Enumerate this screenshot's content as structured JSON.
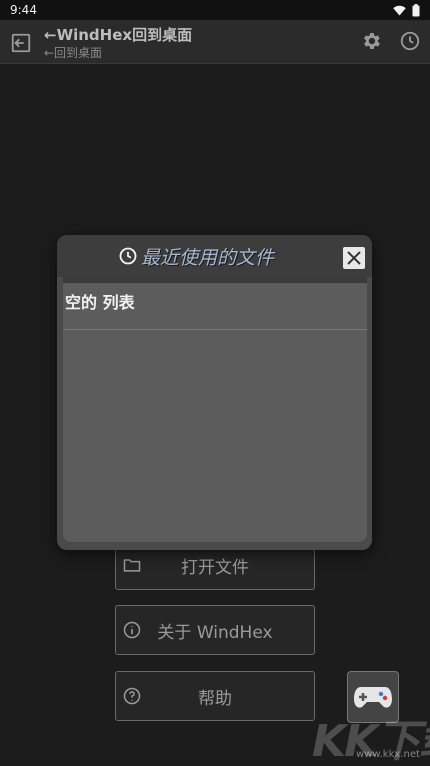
{
  "status_bar": {
    "time": "9:44"
  },
  "app_bar": {
    "title": "←WindHex回到桌面",
    "subtitle": "←回到桌面",
    "icons": [
      "exit-icon",
      "gear-icon",
      "clock-icon"
    ]
  },
  "buttons": {
    "open_file": "打开文件",
    "about": "关于 WindHex",
    "help": "帮助"
  },
  "dialog": {
    "title": "最近使用的文件",
    "empty_list": "空的 列表"
  },
  "watermark": {
    "text": "KK下载",
    "url": "www.kkx.net"
  },
  "colors": {
    "background": "#1c1c1c",
    "app_bar": "#2b2b2b",
    "dialog": "#4a4a4a",
    "dialog_title": "#a6b8cf"
  }
}
